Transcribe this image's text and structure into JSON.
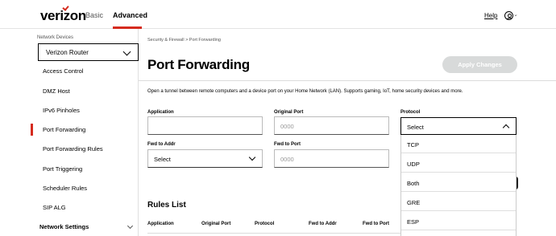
{
  "header": {
    "logo": "verizon",
    "tabs": [
      {
        "label": "Basic",
        "active": false
      },
      {
        "label": "Advanced",
        "active": true
      }
    ],
    "help_label": "Help",
    "accent_color": "#d52b1e"
  },
  "sidebar": {
    "heading": "Network Devices",
    "device_select": "Verizon Router",
    "items": [
      {
        "label": "Access Control"
      },
      {
        "label": "DMZ Host"
      },
      {
        "label": "IPv6 Pinholes"
      },
      {
        "label": "Port Forwarding",
        "active": true
      },
      {
        "label": "Port Forwarding Rules"
      },
      {
        "label": "Port Triggering"
      },
      {
        "label": "Scheduler Rules"
      },
      {
        "label": "SIP ALG"
      }
    ],
    "section": "Network Settings"
  },
  "main": {
    "breadcrumb": "Security & Firewall  >  Port Forwarding",
    "title": "Port Forwarding",
    "apply_label": "Apply Changes",
    "description": "Open a tunnel between remote computers and a device port on your Home Network (LAN). Supports gaming, IoT, home security devices and more.",
    "form": {
      "application": {
        "label": "Application",
        "value": ""
      },
      "original_port": {
        "label": "Original Port",
        "placeholder": "0000"
      },
      "protocol": {
        "label": "Protocol",
        "selected": "Select",
        "options": [
          "TCP",
          "UDP",
          "Both",
          "GRE",
          "ESP"
        ]
      },
      "fwd_to_addr": {
        "label": "Fwd to Addr",
        "selected": "Select"
      },
      "fwd_to_port": {
        "label": "Fwd to Port",
        "placeholder": "0000"
      }
    },
    "rules_list": {
      "title": "Rules List",
      "columns": [
        "Application",
        "Original Port",
        "Protocol",
        "Fwd to Addr",
        "Fwd to Port"
      ]
    }
  }
}
